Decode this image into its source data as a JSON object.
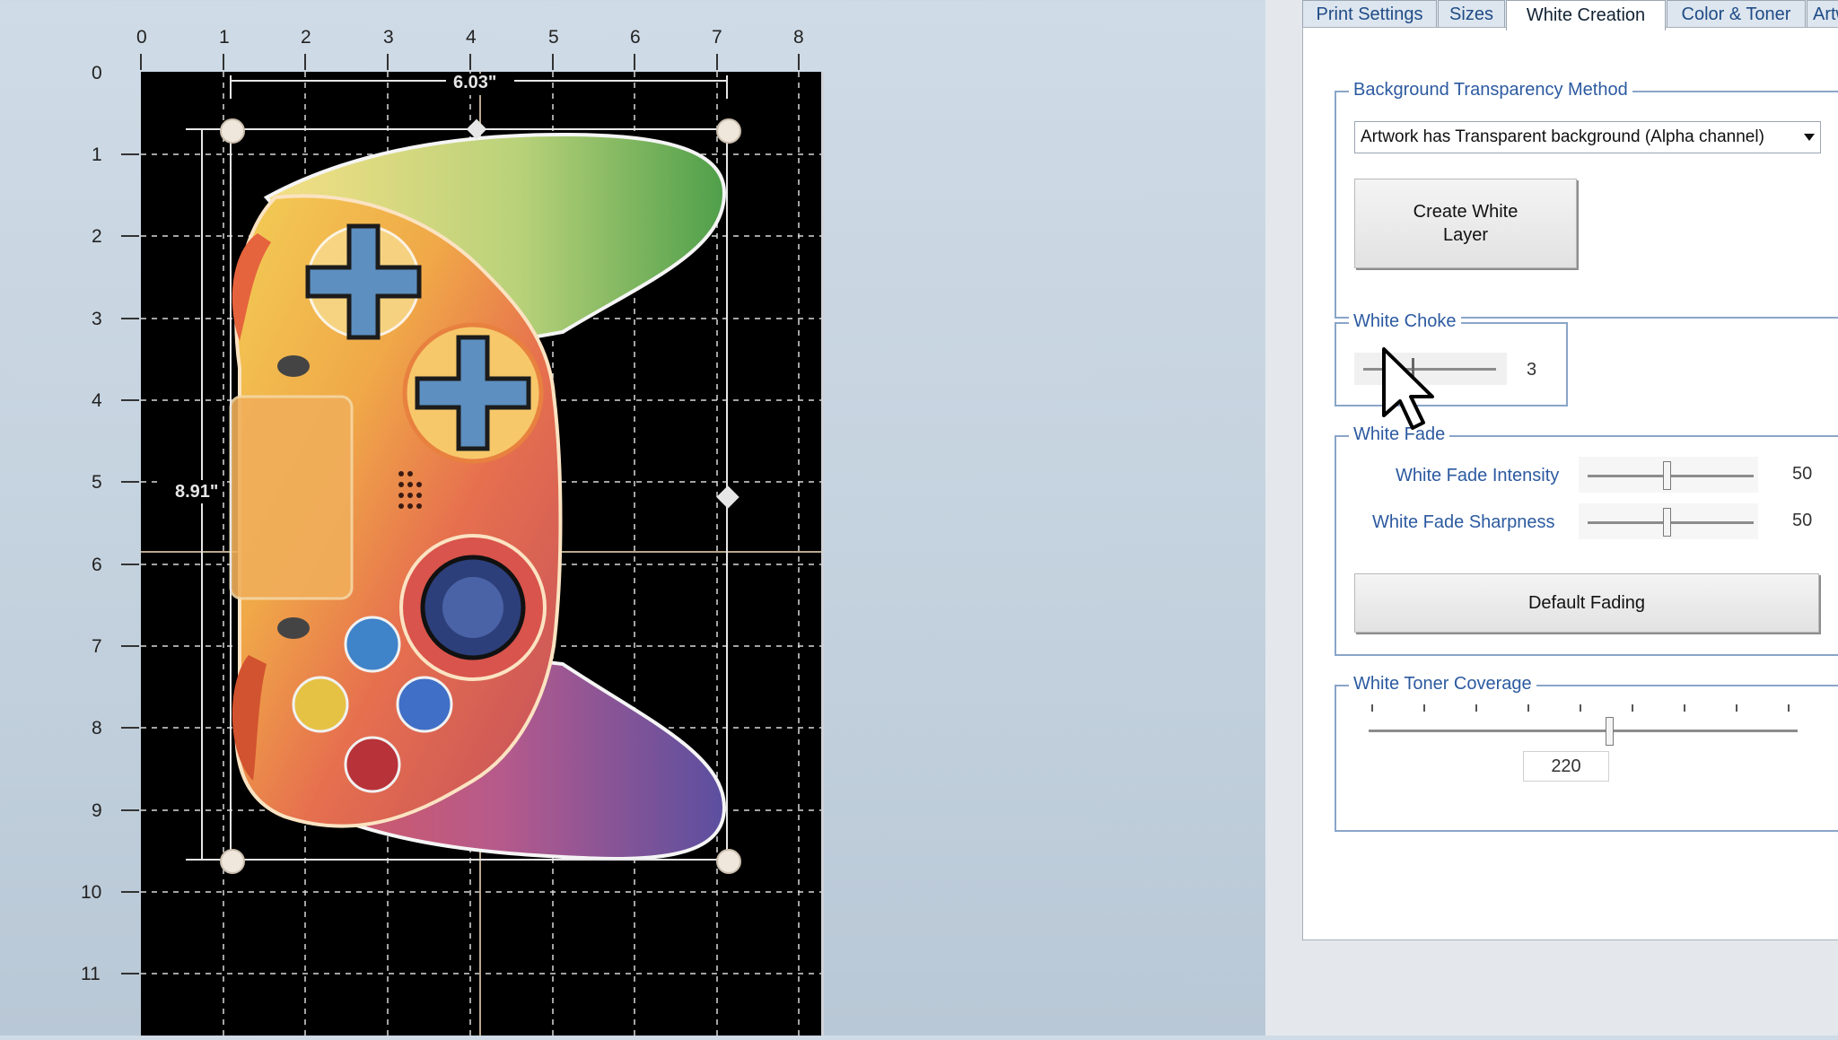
{
  "ruler": {
    "top": [
      "0",
      "1",
      "2",
      "3",
      "4",
      "5",
      "6",
      "7",
      "8"
    ],
    "left": [
      "0",
      "1",
      "2",
      "3",
      "4",
      "5",
      "6",
      "7",
      "8",
      "9",
      "10",
      "11"
    ]
  },
  "artwork": {
    "width_label": "6.03\"",
    "height_label": "8.91\"",
    "icon": "game-controller-icon"
  },
  "tabs": [
    "Print Settings",
    "Sizes",
    "White Creation",
    "Color & Toner",
    "Artwork"
  ],
  "active_tab": "White Creation",
  "background_transparency": {
    "title": "Background Transparency Method",
    "selected": "Artwork has Transparent background (Alpha channel)",
    "create_button": "Create White Layer"
  },
  "white_choke": {
    "title": "White Choke",
    "value": "3"
  },
  "white_fade": {
    "title": "White Fade",
    "intensity_label": "White Fade Intensity",
    "intensity_value": "50",
    "sharpness_label": "White Fade Sharpness",
    "sharpness_value": "50",
    "default_button": "Default Fading"
  },
  "white_toner_coverage": {
    "title": "White Toner Coverage",
    "value": "220"
  },
  "colors": {
    "tab_text": "#1f4b86",
    "group_border": "#8aa5c8",
    "stage_bg": "#000000"
  }
}
